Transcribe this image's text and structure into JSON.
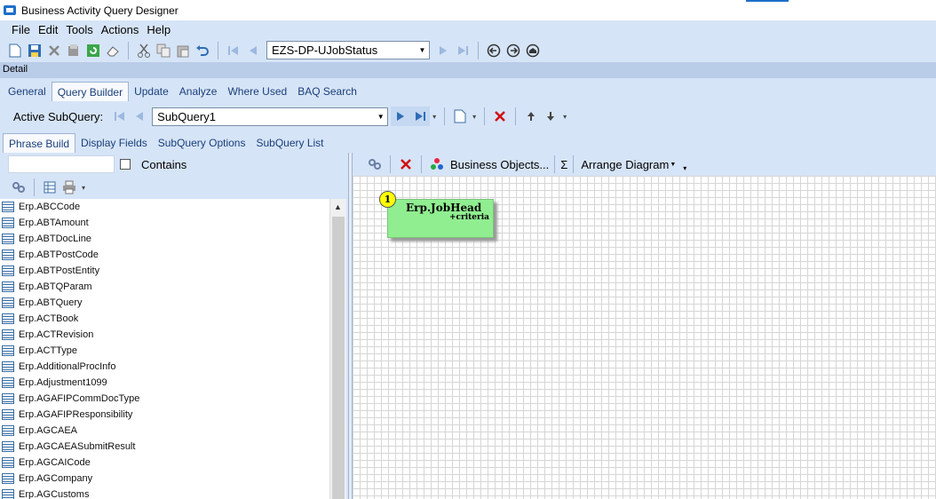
{
  "window": {
    "title": "Business Activity Query Designer"
  },
  "menu": [
    "File",
    "Edit",
    "Tools",
    "Actions",
    "Help"
  ],
  "toolbar": {
    "query_combo": "EZS-DP-UJobStatus"
  },
  "detail_label": "Detail",
  "main_tabs": [
    "General",
    "Query Builder",
    "Update",
    "Analyze",
    "Where Used",
    "BAQ Search"
  ],
  "subquery": {
    "label": "Active SubQuery:",
    "value": "SubQuery1"
  },
  "sub_tabs": [
    "Phrase Build",
    "Display Fields",
    "SubQuery Options",
    "SubQuery List"
  ],
  "left": {
    "search_value": "",
    "contains_label": "Contains",
    "contains_checked": false
  },
  "tables": [
    "Erp.ABCCode",
    "Erp.ABTAmount",
    "Erp.ABTDocLine",
    "Erp.ABTPostCode",
    "Erp.ABTPostEntity",
    "Erp.ABTQParam",
    "Erp.ABTQuery",
    "Erp.ACTBook",
    "Erp.ACTRevision",
    "Erp.ACTType",
    "Erp.AdditionalProcInfo",
    "Erp.Adjustment1099",
    "Erp.AGAFIPCommDocType",
    "Erp.AGAFIPResponsibility",
    "Erp.AGCAEA",
    "Erp.AGCAEASubmitResult",
    "Erp.AGCAICode",
    "Erp.AGCompany",
    "Erp.AGCustoms"
  ],
  "diagram_toolbar": {
    "business_objects": "Business Objects...",
    "sigma": "Σ",
    "arrange": "Arrange Diagram"
  },
  "diagram": {
    "node_badge": "1",
    "node_title": "Erp.JobHead",
    "node_subtitle": "+criteria",
    "node_color": "#90ee90"
  }
}
